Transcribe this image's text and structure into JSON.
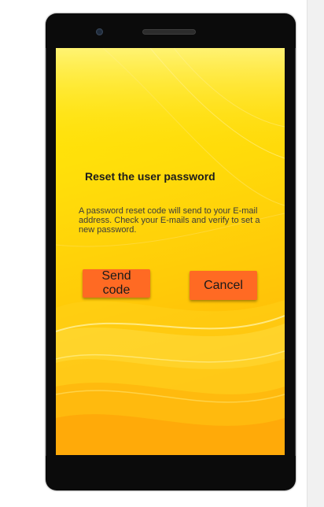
{
  "dialog": {
    "title": "Reset the user password",
    "description": "A password reset code will send to your E-mail address. Check your E-mails and verify to set a new password.",
    "send_code_label": "Send code",
    "cancel_label": "Cancel"
  },
  "colors": {
    "button": "#ff6a23",
    "screen_top": "#ffef0a",
    "screen_bottom": "#ffa405",
    "phone_frame": "#0b0b0b"
  }
}
